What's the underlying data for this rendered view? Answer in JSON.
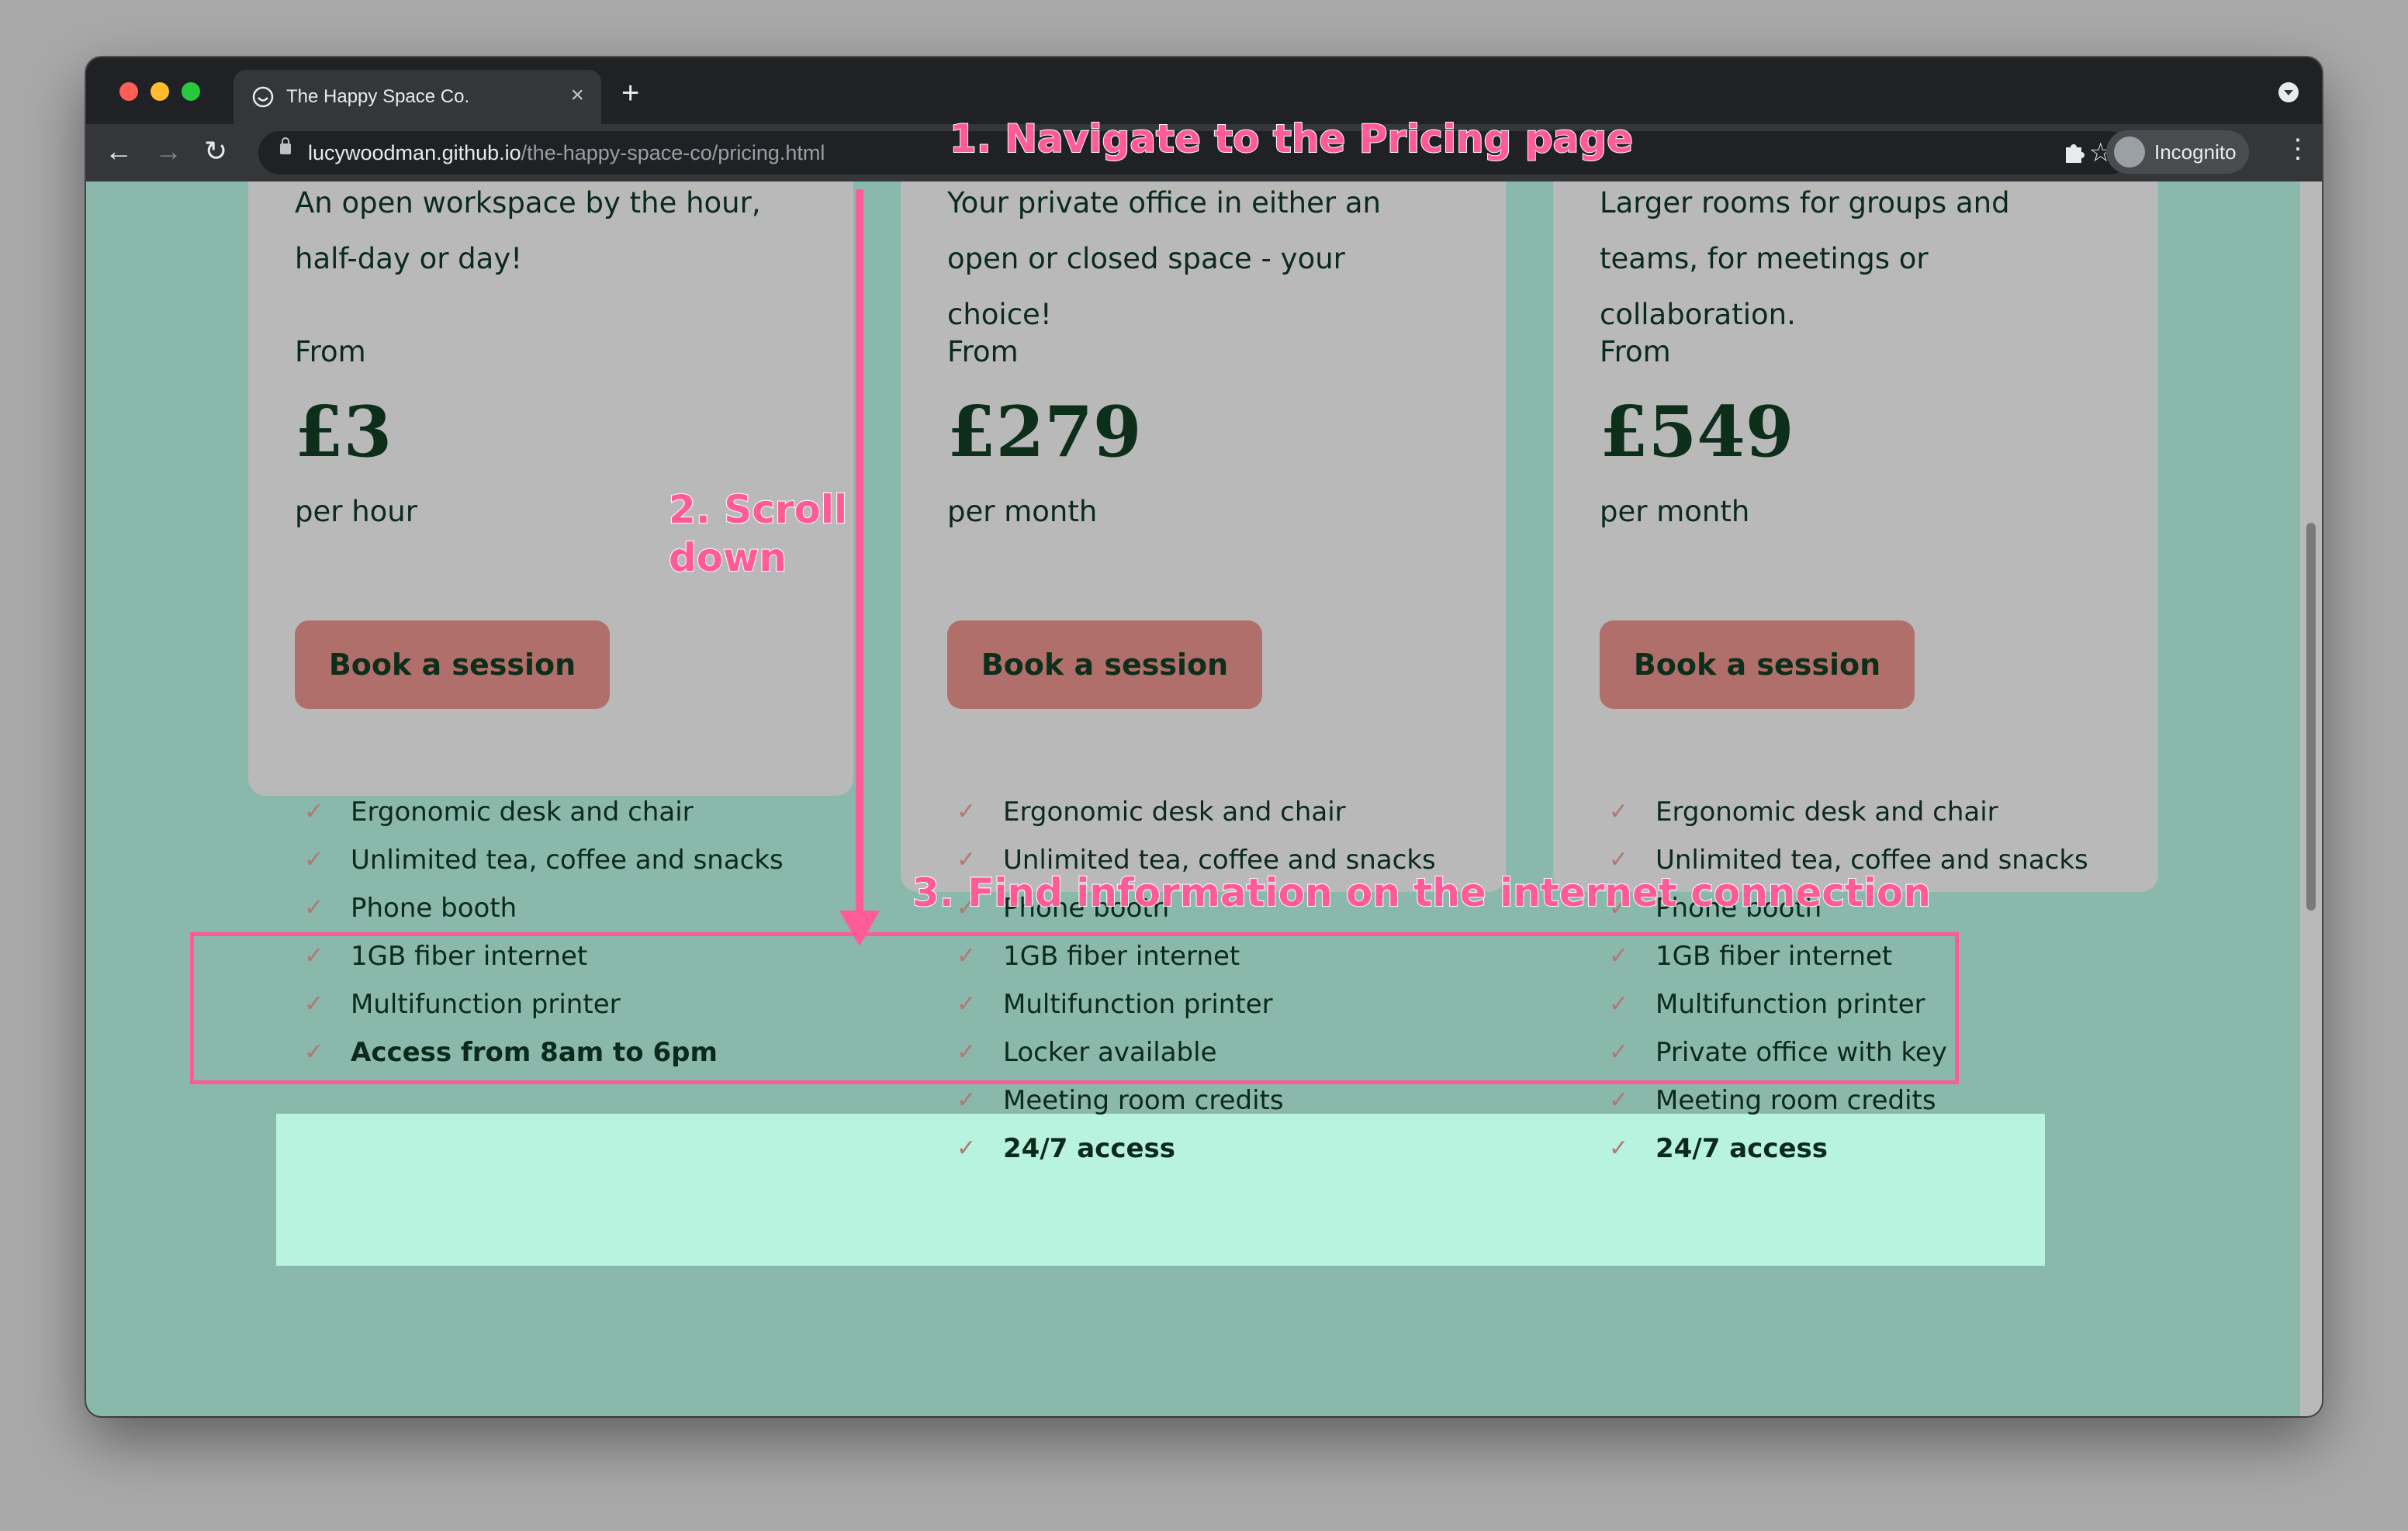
{
  "browser": {
    "tab_title": "The Happy Space Co.",
    "tab_close": "×",
    "new_tab": "+",
    "url_domain": "lucywoodman.github.io",
    "url_path": "/the-happy-space-co/pricing.html",
    "profile_label": "Incognito",
    "back": "←",
    "forward": "→",
    "reload": "↻",
    "bookmark": "☆",
    "menu": "⋮"
  },
  "cards": [
    {
      "description": "An open workspace by the hour, half-day or day!",
      "from_label": "From",
      "price": "£3",
      "period": "per hour",
      "cta": "Book a session",
      "features": [
        {
          "text": "Ergonomic desk and chair",
          "bold": false
        },
        {
          "text": "Unlimited tea, coffee and snacks",
          "bold": false
        },
        {
          "text": "Phone booth",
          "bold": false
        },
        {
          "text": "1GB fiber internet",
          "bold": false
        },
        {
          "text": "Multifunction printer",
          "bold": false
        },
        {
          "text": "Access from 8am to 6pm",
          "bold": true
        }
      ]
    },
    {
      "description": "Your private office in either an open or closed space - your choice!",
      "from_label": "From",
      "price": "£279",
      "period": "per month",
      "cta": "Book a session",
      "features": [
        {
          "text": "Ergonomic desk and chair",
          "bold": false
        },
        {
          "text": "Unlimited tea, coffee and snacks",
          "bold": false
        },
        {
          "text": "Phone booth",
          "bold": false
        },
        {
          "text": "1GB fiber internet",
          "bold": false
        },
        {
          "text": "Multifunction printer",
          "bold": false
        },
        {
          "text": "Locker available",
          "bold": false
        },
        {
          "text": "Meeting room credits",
          "bold": false
        },
        {
          "text": "24/7 access",
          "bold": true
        }
      ]
    },
    {
      "description": "Larger rooms for groups and teams, for meetings or collaboration.",
      "from_label": "From",
      "price": "£549",
      "period": "per month",
      "cta": "Book a session",
      "features": [
        {
          "text": "Ergonomic desk and chair",
          "bold": false
        },
        {
          "text": "Unlimited tea, coffee and snacks",
          "bold": false
        },
        {
          "text": "Phone booth",
          "bold": false
        },
        {
          "text": "1GB fiber internet",
          "bold": false
        },
        {
          "text": "Multifunction printer",
          "bold": false
        },
        {
          "text": "Private office with key",
          "bold": false
        },
        {
          "text": "Meeting room credits",
          "bold": false
        },
        {
          "text": "24/7 access",
          "bold": true
        }
      ]
    }
  ],
  "check_glyph": "✓",
  "annotations": {
    "step1": "1. Navigate to the Pricing page",
    "step2": "2. Scroll down",
    "step3": "3. Find information on the internet connection"
  },
  "colors": {
    "page_bg": "#8ab8aa",
    "card_bg": "#b9b9b9",
    "button_bg": "#b06f6a",
    "annotation": "#ff5b96",
    "highlight_fill": "#b8f3e0"
  }
}
